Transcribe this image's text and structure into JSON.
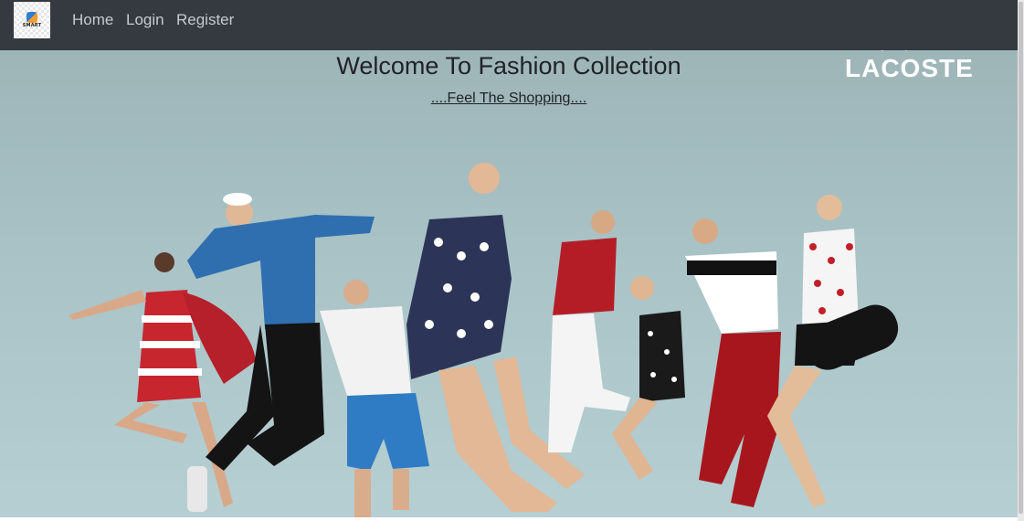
{
  "navbar": {
    "brand_text": "SMART",
    "links": [
      {
        "label": "Home"
      },
      {
        "label": "Login"
      },
      {
        "label": "Register"
      }
    ],
    "background": "#343a40",
    "link_color": "#c7cbcf"
  },
  "hero": {
    "title": "Welcome To Fashion Collection",
    "subtitle": "....Feel The Shopping....",
    "logo_text": "LACOSTE",
    "sky_color": "#a9c3c7"
  }
}
